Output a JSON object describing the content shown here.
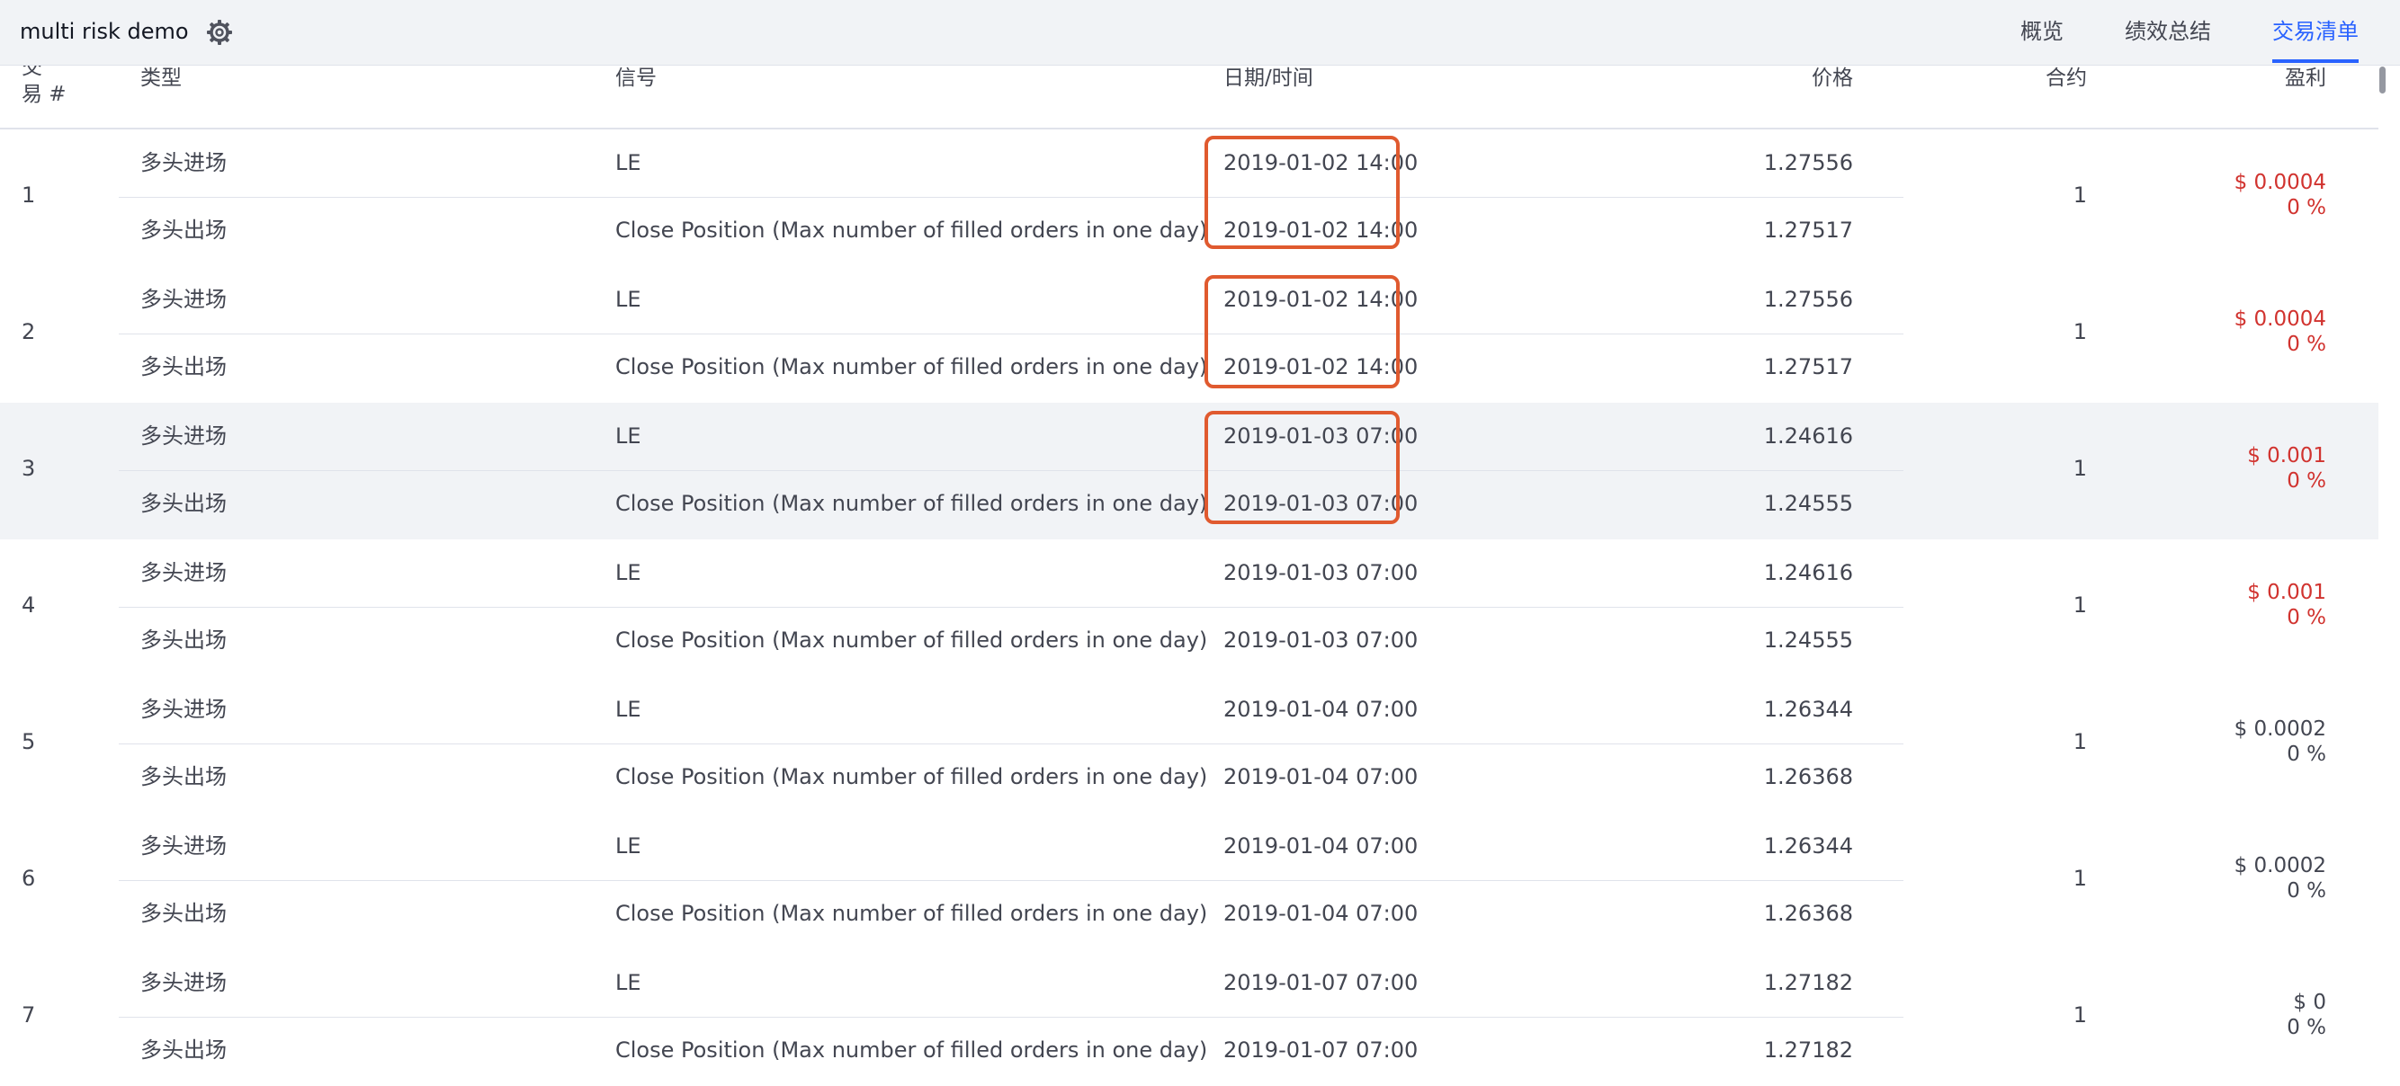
{
  "app": {
    "title": "multi risk demo",
    "settings_icon": "gear-icon"
  },
  "tabs": [
    {
      "label": "概览",
      "active": false
    },
    {
      "label": "绩效总结",
      "active": false
    },
    {
      "label": "交易清单",
      "active": true
    }
  ],
  "table": {
    "headers": {
      "trade_no_line1": "交",
      "trade_no_line2": "易 #",
      "type": "类型",
      "signal": "信号",
      "datetime": "日期/时间",
      "price": "价格",
      "contracts": "合约",
      "profit": "盈利"
    },
    "trades": [
      {
        "no": "1",
        "contracts": "1",
        "profit": "$ 0.0004",
        "profit_pct": "0 %",
        "entry": {
          "type": "多头进场",
          "signal": "LE",
          "datetime": "2019-01-02 14:00",
          "price": "1.27556"
        },
        "exit": {
          "type": "多头出场",
          "signal": "Close Position (Max number of filled orders in one day)",
          "datetime": "2019-01-02 14:00",
          "price": "1.27517"
        }
      },
      {
        "no": "2",
        "contracts": "1",
        "profit": "$ 0.0004",
        "profit_pct": "0 %",
        "entry": {
          "type": "多头进场",
          "signal": "LE",
          "datetime": "2019-01-02 14:00",
          "price": "1.27556"
        },
        "exit": {
          "type": "多头出场",
          "signal": "Close Position (Max number of filled orders in one day)",
          "datetime": "2019-01-02 14:00",
          "price": "1.27517"
        }
      },
      {
        "no": "3",
        "contracts": "1",
        "profit": "$ 0.001",
        "profit_pct": "0 %",
        "entry": {
          "type": "多头进场",
          "signal": "LE",
          "datetime": "2019-01-03 07:00",
          "price": "1.24616"
        },
        "exit": {
          "type": "多头出场",
          "signal": "Close Position (Max number of filled orders in one day)",
          "datetime": "2019-01-03 07:00",
          "price": "1.24555"
        }
      },
      {
        "no": "4",
        "contracts": "1",
        "profit": "$ 0.001",
        "profit_pct": "0 %",
        "entry": {
          "type": "多头进场",
          "signal": "LE",
          "datetime": "2019-01-03 07:00",
          "price": "1.24616"
        },
        "exit": {
          "type": "多头出场",
          "signal": "Close Position (Max number of filled orders in one day)",
          "datetime": "2019-01-03 07:00",
          "price": "1.24555"
        }
      },
      {
        "no": "5",
        "contracts": "1",
        "profit": "$ 0.0002",
        "profit_pct": "0 %",
        "entry": {
          "type": "多头进场",
          "signal": "LE",
          "datetime": "2019-01-04 07:00",
          "price": "1.26344"
        },
        "exit": {
          "type": "多头出场",
          "signal": "Close Position (Max number of filled orders in one day)",
          "datetime": "2019-01-04 07:00",
          "price": "1.26368"
        }
      },
      {
        "no": "6",
        "contracts": "1",
        "profit": "$ 0.0002",
        "profit_pct": "0 %",
        "entry": {
          "type": "多头进场",
          "signal": "LE",
          "datetime": "2019-01-04 07:00",
          "price": "1.26344"
        },
        "exit": {
          "type": "多头出场",
          "signal": "Close Position (Max number of filled orders in one day)",
          "datetime": "2019-01-04 07:00",
          "price": "1.26368"
        }
      },
      {
        "no": "7",
        "contracts": "1",
        "profit": "$ 0",
        "profit_pct": "0 %",
        "entry": {
          "type": "多头进场",
          "signal": "LE",
          "datetime": "2019-01-07 07:00",
          "price": "1.27182"
        },
        "exit": {
          "type": "多头出场",
          "signal": "Close Position (Max number of filled orders in one day)",
          "datetime": "2019-01-07 07:00",
          "price": "1.27182"
        }
      }
    ]
  },
  "colors": {
    "profit_red": "#d1332f",
    "accent_blue": "#2962ff",
    "highlight_box": "#e05a2f",
    "row_highlight": "#f1f3f6"
  }
}
